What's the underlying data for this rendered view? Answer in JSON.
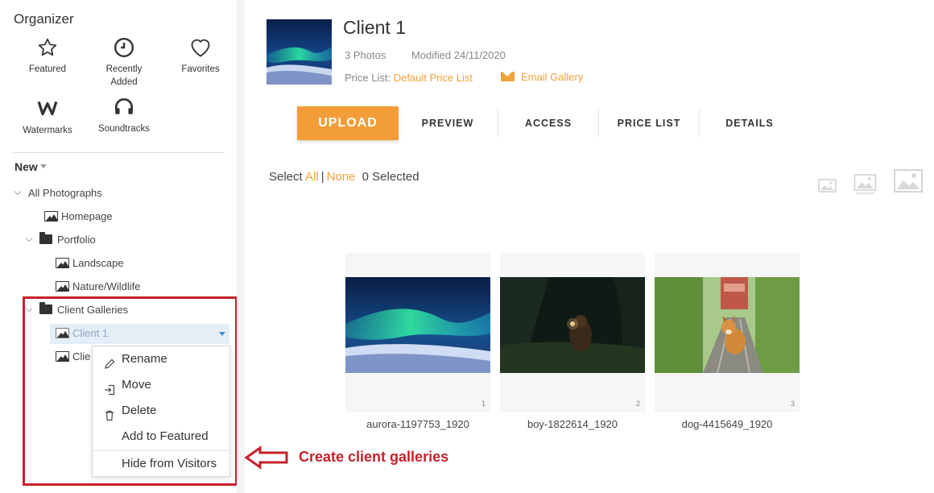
{
  "sidebar": {
    "organizer_title": "Organizer",
    "organizer_items": [
      {
        "label": "Featured",
        "icon": "star-icon"
      },
      {
        "label": "Recently Added",
        "icon": "clock-icon"
      },
      {
        "label": "Favorites",
        "icon": "heart-icon"
      },
      {
        "label": "Watermarks",
        "icon": "watermark-w-icon"
      },
      {
        "label": "Soundtracks",
        "icon": "headphones-icon"
      }
    ],
    "new_label": "New",
    "tree": {
      "all_photographs": "All Photographs",
      "homepage": "Homepage",
      "portfolio": "Portfolio",
      "landscape": "Landscape",
      "nature_wildlife": "Nature/Wildlife",
      "client_galleries": "Client Galleries",
      "client1": "Client 1",
      "client2_partial": "Clie"
    },
    "context_menu": [
      {
        "label": "Rename",
        "icon": "pencil-icon"
      },
      {
        "label": "Move",
        "icon": "move-icon"
      },
      {
        "label": "Delete",
        "icon": "trash-icon"
      },
      {
        "label": "Add to Featured",
        "icon": ""
      },
      {
        "label": "Hide from Visitors",
        "icon": ""
      }
    ]
  },
  "gallery": {
    "title": "Client 1",
    "photos_count": "3 Photos",
    "modified": "Modified 24/11/2020",
    "price_list_label": "Price List:",
    "price_list_value": "Default Price List",
    "email_gallery": "Email Gallery"
  },
  "toolbar": {
    "upload": "UPLOAD",
    "tabs": [
      "PREVIEW",
      "ACCESS",
      "PRICE LIST",
      "DETAILS"
    ]
  },
  "selection": {
    "select_label": "Select",
    "all": "All",
    "divider": "|",
    "none": "None",
    "selected_count": "0 Selected"
  },
  "photos": [
    {
      "name": "aurora-1197753_1920",
      "index": "1"
    },
    {
      "name": "boy-1822614_1920",
      "index": "2"
    },
    {
      "name": "dog-4415649_1920",
      "index": "3"
    }
  ],
  "annotation": {
    "text": "Create client galleries"
  },
  "colors": {
    "accent": "#f29d38",
    "link": "#f0a23b",
    "annotation_red": "#c8202b",
    "selected_row": "#e4eef7"
  }
}
